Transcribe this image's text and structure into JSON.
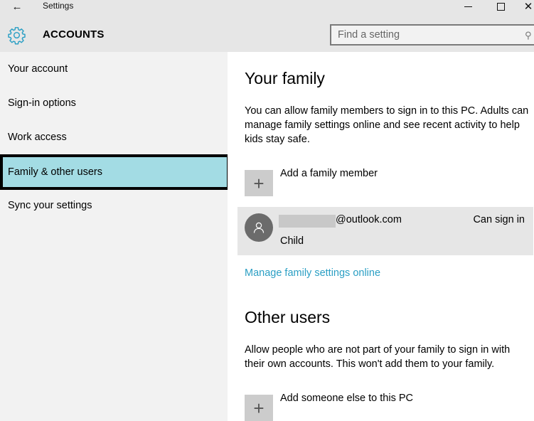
{
  "window": {
    "title": "Settings",
    "back_glyph": "←",
    "close_glyph": "✕",
    "controls": [
      "minimize",
      "maximize",
      "close"
    ]
  },
  "header": {
    "icon": "gear-icon",
    "section_title": "ACCOUNTS",
    "search": {
      "placeholder": "Find a setting",
      "value": "",
      "icon": "search-icon",
      "icon_glyph": "⚲"
    }
  },
  "colors": {
    "accent": "#2b9fc4",
    "selected_nav_bg": "#a3dce4",
    "sidebar_bg": "#f2f2f2",
    "titlebar_bg": "#e6e6e6",
    "card_bg": "#e6e6e6",
    "tile_bg": "#cccccc",
    "avatar_bg": "#6b6b6b"
  },
  "sidebar": {
    "items": [
      {
        "label": "Your account",
        "active": false
      },
      {
        "label": "Sign-in options",
        "active": false
      },
      {
        "label": "Work access",
        "active": false
      },
      {
        "label": "Family & other users",
        "active": true
      },
      {
        "label": "Sync your settings",
        "active": false
      }
    ]
  },
  "main": {
    "family": {
      "heading": "Your family",
      "description": "You can allow family members to sign in to this PC. Adults can manage family settings online and see recent activity to help kids stay safe.",
      "add_label": "Add a family member",
      "plus_glyph": "+",
      "member": {
        "email_suffix": "@outlook.com",
        "role": "Child",
        "status": "Can sign in",
        "icon": "user-icon"
      },
      "manage_link": "Manage family settings online"
    },
    "other_users": {
      "heading": "Other users",
      "description": "Allow people who are not part of your family to sign in with their own accounts. This won't add them to your family.",
      "add_label": "Add someone else to this PC",
      "plus_glyph": "+"
    }
  }
}
